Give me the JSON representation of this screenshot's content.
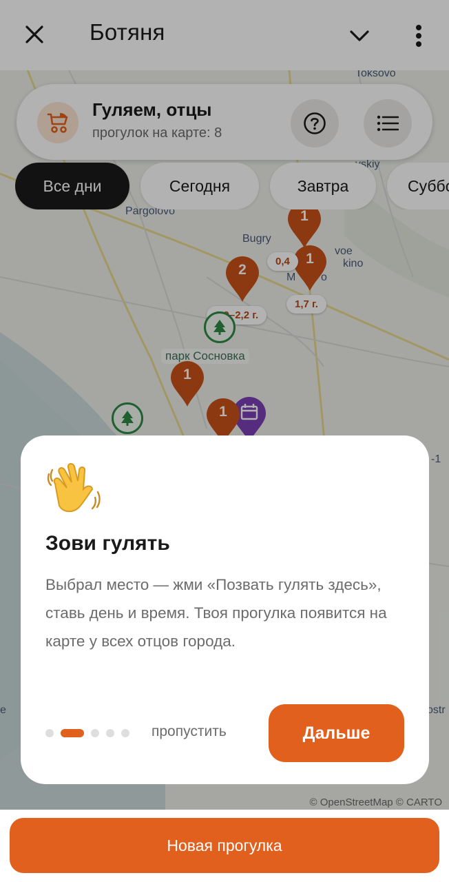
{
  "header": {
    "title": "Ботяня",
    "close_icon": "close-icon",
    "chevron_icon": "chevron-down-icon",
    "more_icon": "more-vertical-icon"
  },
  "info_card": {
    "title": "Гуляем, отцы",
    "subtitle": "прогулок на карте: 8",
    "stroller_icon": "stroller-icon",
    "help_icon": "help-icon",
    "list_icon": "list-icon"
  },
  "chips": [
    {
      "label": "Все дни",
      "active": true
    },
    {
      "label": "Сегодня",
      "active": false
    },
    {
      "label": "Завтра",
      "active": false
    },
    {
      "label": "Суббота",
      "active": false
    }
  ],
  "map": {
    "labels": {
      "toksovo": "Toksovo",
      "vsky": "vskiy",
      "pargolovo": "Pargolovo",
      "bugry": "Bugry",
      "voe": "voe",
      "kino": "kino",
      "m": "M",
      "o": "o",
      "park": "парк Сосновка",
      "edge_1": "-1",
      "edge_e": "e",
      "edge_ostr": "ostr"
    },
    "price_tags": [
      "0,4",
      "1,7 г.",
      "1,9–2,2 г."
    ],
    "pins": [
      "1",
      "1",
      "2",
      "1",
      "1"
    ],
    "attribution": "© OpenStreetMap © CARTO",
    "colors": {
      "pin": "#c9521a",
      "event_pin": "#7a3fb5",
      "tree": "#2f8a45"
    }
  },
  "modal": {
    "emoji": "👋",
    "title": "Зови гулять",
    "body": "Выбрал место — жми «Позвать гулять здесь», ставь день и время. Твоя прогулка появится на карте у всех отцов города.",
    "step_total": 5,
    "step_active": 2,
    "skip_label": "пропустить",
    "next_label": "Дальше"
  },
  "bottom": {
    "new_walk_label": "Новая прогулка"
  },
  "colors": {
    "accent": "#e2601d",
    "chip_active": "#1b1b1b"
  }
}
